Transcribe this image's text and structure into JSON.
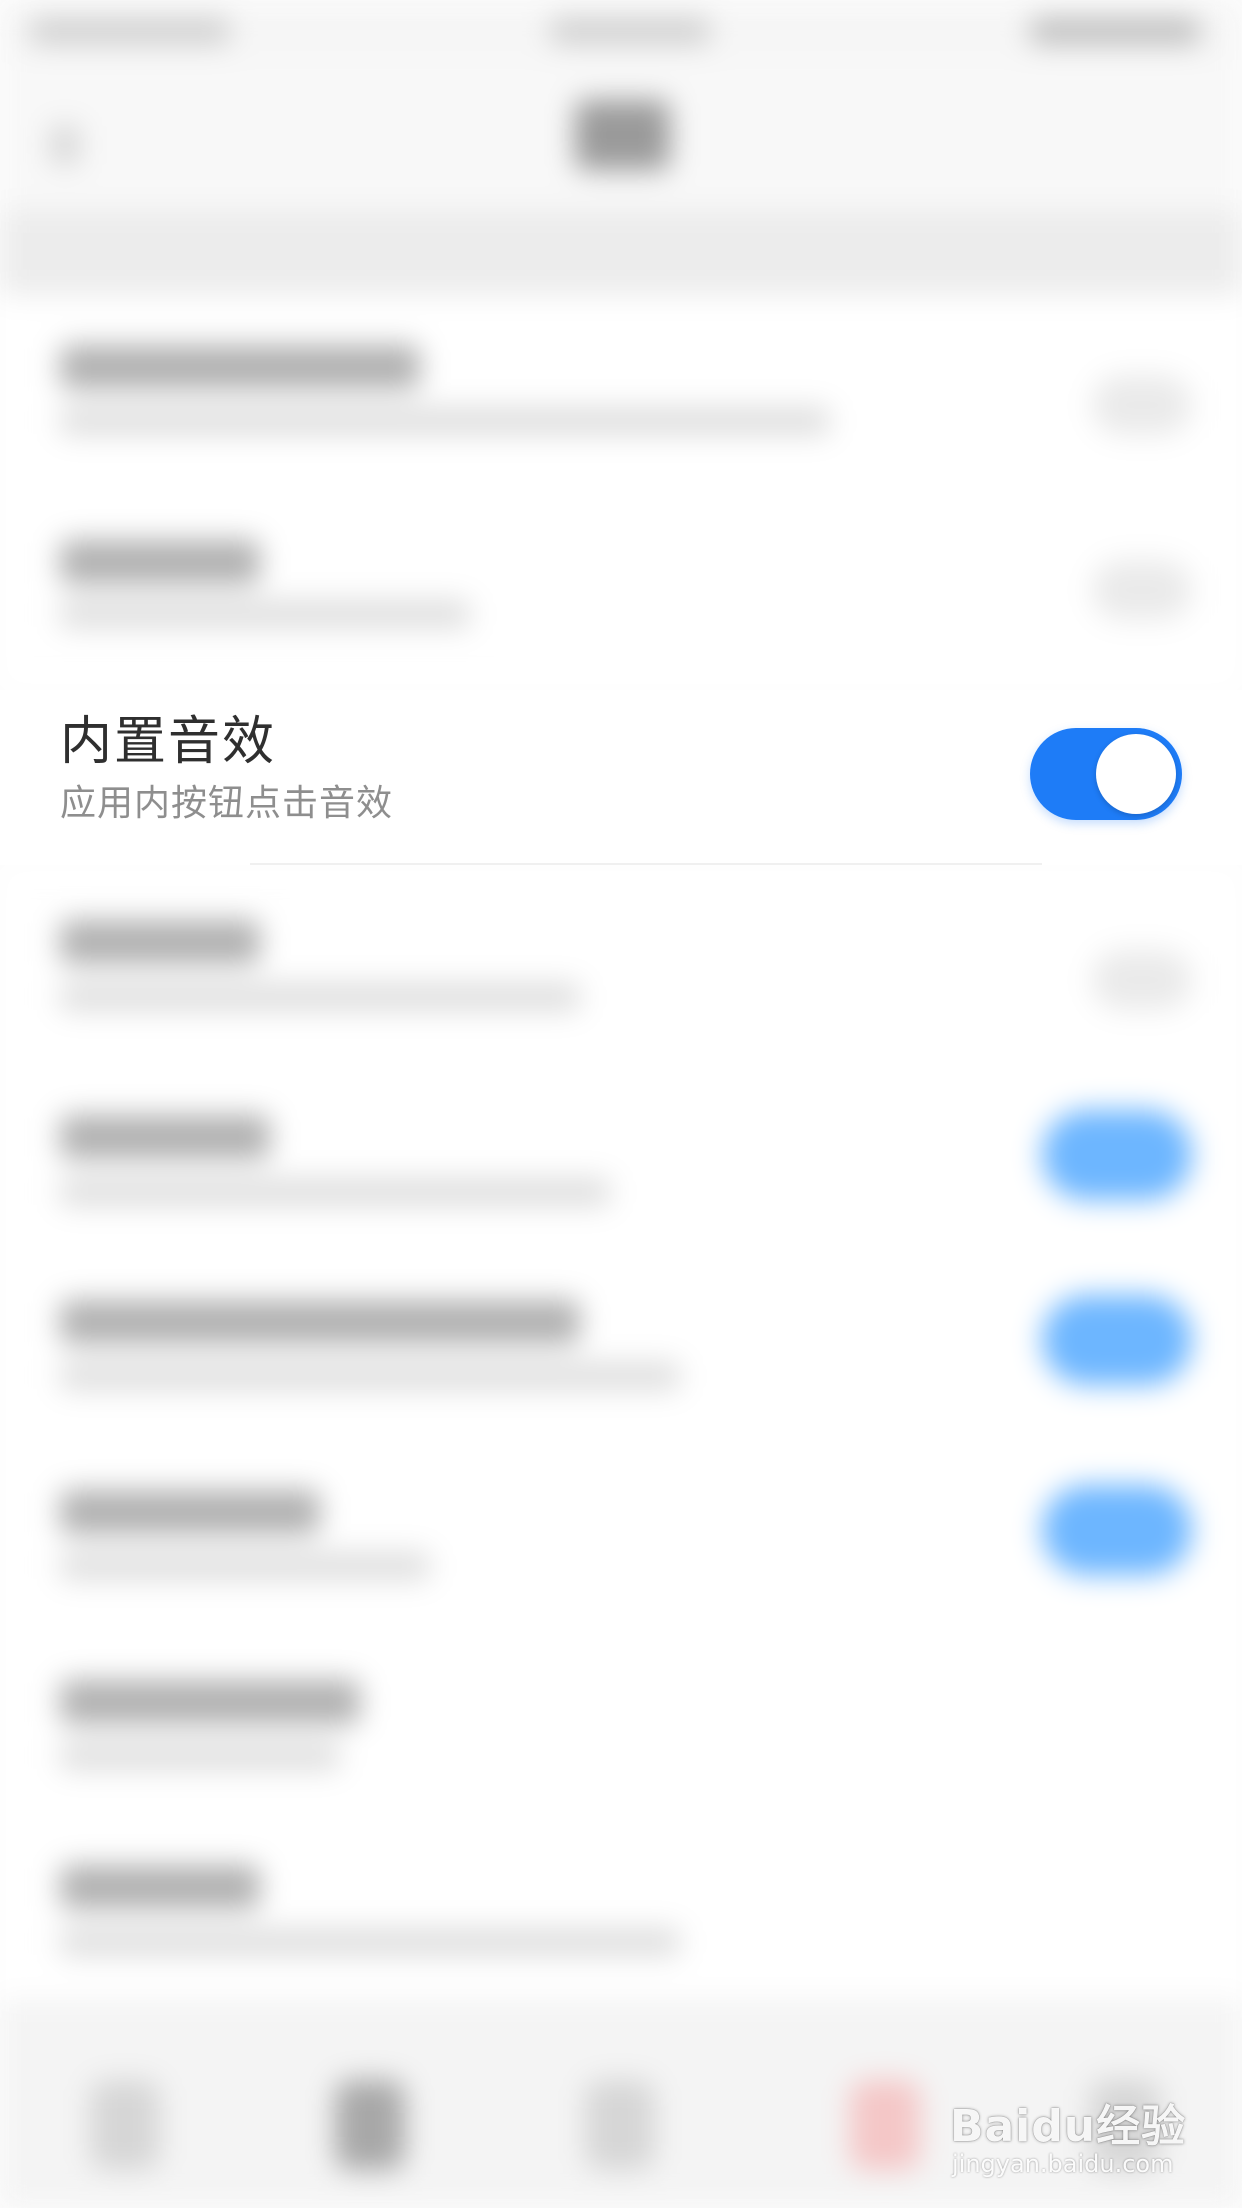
{
  "focused_setting": {
    "title": "内置音效",
    "subtitle": "应用内按钮点击音效",
    "toggle_on": true
  },
  "colors": {
    "toggle_on": "#1e7cf7",
    "toggle_knob": "#ffffff",
    "title_text": "#2f2f2f",
    "subtitle_text": "#8e8e8e",
    "blurred_toggle_on": "#6db6ff"
  },
  "watermark": {
    "logo": "Baidu经验",
    "url": "jingyan.baidu.com"
  }
}
